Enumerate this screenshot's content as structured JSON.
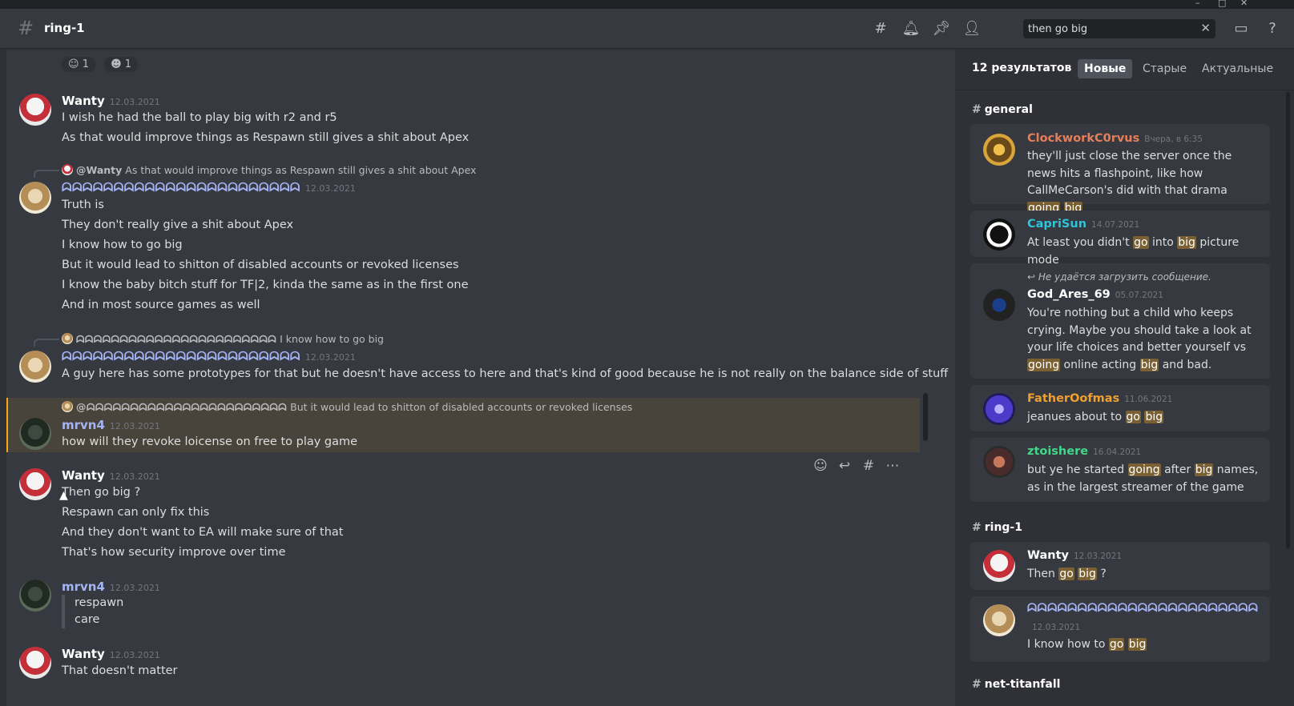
{
  "header": {
    "channel": "ring-1",
    "search_value": "then go big",
    "icons": [
      "threads-icon",
      "bell-icon",
      "pin-icon",
      "members-icon",
      "inbox-icon",
      "help-icon"
    ]
  },
  "chat": {
    "reactions": [
      {
        "count": "1"
      },
      {
        "count": "1"
      }
    ],
    "msg1": {
      "author": "Wanty",
      "time": "12.03.2021",
      "lines": [
        "I wish he had the ball to play big with r2 and r5",
        "As that would improve things as Respawn still gives a shit about Apex"
      ]
    },
    "msg2": {
      "reply_name": "@Wanty",
      "reply_text": "As that would improve things as Respawn still gives a shit about Apex",
      "author": "ᗣᗣᗣᗣᗣᗣᗣᗣᗣᗣᗣᗣᗣᗣᗣᗣᗣᗣᗣᗣᗣᗣᗣ",
      "time": "12.03.2021",
      "lines": [
        "Truth is",
        "They don't really give a shit about Apex",
        "I know how to go big",
        "But it would lead to shitton of disabled accounts or revoked licenses",
        "I know the baby bitch stuff for TF|2, kinda the same as in the first one",
        "And in most source games as well"
      ]
    },
    "msg3": {
      "reply_name": "ᗣᗣᗣᗣᗣᗣᗣᗣᗣᗣᗣᗣᗣᗣᗣᗣᗣᗣᗣᗣᗣᗣᗣ",
      "reply_text": "I know how to go big",
      "author": "ᗣᗣᗣᗣᗣᗣᗣᗣᗣᗣᗣᗣᗣᗣᗣᗣᗣᗣᗣᗣᗣᗣᗣ",
      "time": "12.03.2021",
      "lines": [
        "A guy here has some prototypes for that but he doesn't have access to here and that's kind of good because he is not really on the balance side of stuff"
      ]
    },
    "msg4": {
      "reply_name": "@ᗣᗣᗣᗣᗣᗣᗣᗣᗣᗣᗣᗣᗣᗣᗣᗣᗣᗣᗣᗣᗣᗣᗣ",
      "reply_text": "But it would lead to shitton of disabled accounts or revoked licenses",
      "author": "mrvn4",
      "time": "12.03.2021",
      "lines": [
        "how will they revoke loicense on free to play game"
      ]
    },
    "msg5": {
      "author": "Wanty",
      "time": "12.03.2021",
      "lines": [
        "Then go big ?",
        "Respawn can only fix this",
        "And they don't want to EA will make sure of that",
        "That's how security improve over time"
      ]
    },
    "msg6": {
      "author": "mrvn4",
      "time": "12.03.2021",
      "quote": [
        "respawn",
        "care"
      ]
    },
    "msg7": {
      "author": "Wanty",
      "time": "12.03.2021",
      "lines": [
        "That doesn't matter"
      ]
    }
  },
  "panel": {
    "count": "12 результатов",
    "tabs": [
      "Новые",
      "Старые",
      "Актуальные"
    ],
    "sections": [
      {
        "channel": "general"
      },
      {
        "channel": "ring-1"
      },
      {
        "channel": "net-titanfall"
      }
    ],
    "results": {
      "r1": {
        "author": "ClockworkC0rvus",
        "time": "Вчера, в 6:35",
        "author_color": "#e67e5a",
        "t1": "they'll just close the server once the news hits a flashpoint, like how CallMeCarson's did with that drama ",
        "h1": "going",
        "h2": "big"
      },
      "r2": {
        "author": "CapriSun",
        "time": "14.07.2021",
        "author_color": "#2ec4d9",
        "t1": "At least you didn't ",
        "h1": "go",
        "t2": " into ",
        "h2": "big",
        "t3": " picture mode"
      },
      "r3": {
        "note": "Не удаётся загрузить сообщение.",
        "author": "God_Ares_69",
        "time": "05.07.2021",
        "author_color": "#ffffff",
        "t1": "You're nothing but a child who keeps crying. Maybe you should take a look at your life choices and better yourself vs ",
        "h1": "going",
        "t2": " online acting ",
        "h2": "big",
        "t3": " and bad."
      },
      "r4": {
        "author": "FatherOofmas",
        "time": "11.06.2021",
        "author_color": "#f0a030",
        "t1": "jeanues about to ",
        "h1": "go",
        "h2": "big"
      },
      "r5": {
        "author": "ztoishere",
        "time": "16.04.2021",
        "author_color": "#43d68a",
        "t1": "but ye he started ",
        "h1": "going",
        "t2": " after ",
        "h2": "big",
        "t3": " names, as in the largest streamer of the game"
      },
      "r6": {
        "author": "Wanty",
        "time": "12.03.2021",
        "author_color": "#ffffff",
        "t1": "Then ",
        "h1": "go",
        "h2": "big",
        "t3": " ?"
      },
      "r7": {
        "author": "ᗣᗣᗣᗣᗣᗣᗣᗣᗣᗣᗣᗣᗣᗣᗣᗣᗣᗣᗣᗣᗣᗣᗣ",
        "time": "12.03.2021",
        "author_color": "#a5b4f5",
        "t1": "I know how to ",
        "h1": "go",
        "h2": "big"
      }
    }
  }
}
